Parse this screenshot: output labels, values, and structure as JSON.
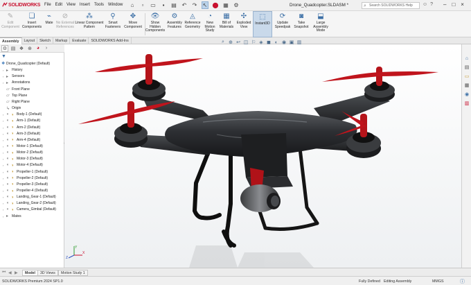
{
  "app": {
    "brand": "SOLIDWORKS",
    "doc_title": "Drone_Quadcopter.SLDASM *",
    "brand_color": "#c8102e"
  },
  "menu": [
    "File",
    "Edit",
    "View",
    "Insert",
    "Tools",
    "Window"
  ],
  "help_search": {
    "placeholder": "Search SOLIDWORKS Help"
  },
  "commands": [
    {
      "label": "Insert\nComponents",
      "enabled": true
    },
    {
      "label": "Mate",
      "enabled": true
    },
    {
      "label": "Linear Component\nPattern",
      "enabled": false
    },
    {
      "label": "Smart\nFasteners",
      "enabled": true
    },
    {
      "label": "Move\nComponent",
      "enabled": true
    },
    {
      "label": "Show\nHidden\nComponents",
      "enabled": true
    },
    {
      "label": "Assembly\nFeatures",
      "enabled": true
    },
    {
      "label": "Reference\nGeometry",
      "enabled": true
    },
    {
      "label": "New\nMotion\nStudy",
      "enabled": true
    },
    {
      "label": "Bill of\nMaterials",
      "enabled": true
    },
    {
      "label": "Exploded\nView",
      "enabled": true
    },
    {
      "label": "Instant3D",
      "enabled": true
    },
    {
      "label": "Update\nSpeedpak",
      "enabled": true
    },
    {
      "label": "Take\nSnapshot",
      "enabled": true
    },
    {
      "label": "Large\nAssembly\nMode",
      "enabled": true
    }
  ],
  "extra_commands": {
    "edit_component": "Edit\nComponent",
    "no_external": "No External\nReferences",
    "pattern": "Linear Component\nPattern"
  },
  "cmd_tabs": [
    "Assembly",
    "Layout",
    "Sketch",
    "Markup",
    "Evaluate",
    "SOLIDWORKS Add-Ins"
  ],
  "tree": {
    "root": "Drone_Quadcopter (Default)",
    "items": [
      {
        "label": "History",
        "kind": "folder"
      },
      {
        "label": "Sensors",
        "kind": "folder"
      },
      {
        "label": "Annotations",
        "kind": "folder"
      },
      {
        "label": "Front Plane",
        "kind": "plane"
      },
      {
        "label": "Top Plane",
        "kind": "plane"
      },
      {
        "label": "Right Plane",
        "kind": "plane"
      },
      {
        "label": "Origin",
        "kind": "origin"
      },
      {
        "label": "Body-1 (Default)",
        "kind": "part"
      },
      {
        "label": "Arm-1 (Default)",
        "kind": "part"
      },
      {
        "label": "Arm-2 (Default)",
        "kind": "part"
      },
      {
        "label": "Arm-3 (Default)",
        "kind": "part"
      },
      {
        "label": "Arm-4 (Default)",
        "kind": "part"
      },
      {
        "label": "Motor-1 (Default)",
        "kind": "part"
      },
      {
        "label": "Motor-2 (Default)",
        "kind": "part"
      },
      {
        "label": "Motor-3 (Default)",
        "kind": "part"
      },
      {
        "label": "Motor-4 (Default)",
        "kind": "part"
      },
      {
        "label": "Propeller-1 (Default)",
        "kind": "part"
      },
      {
        "label": "Propeller-2 (Default)",
        "kind": "part"
      },
      {
        "label": "Propeller-3 (Default)",
        "kind": "part"
      },
      {
        "label": "Propeller-4 (Default)",
        "kind": "part"
      },
      {
        "label": "Landing_Gear-1 (Default)",
        "kind": "part"
      },
      {
        "label": "Landing_Gear-2 (Default)",
        "kind": "part"
      },
      {
        "label": "Camera_Gimbal (Default)",
        "kind": "part"
      },
      {
        "label": "Mates",
        "kind": "folder"
      }
    ]
  },
  "bottom_tabs": [
    "Model",
    "3D Views",
    "Motion Study 1"
  ],
  "status": {
    "edition": "SOLIDWORKS Premium 2024 SP1.0",
    "defined": "Fully Defined",
    "mode": "Editing Assembly",
    "units": "MMGS"
  },
  "colors": {
    "propeller": "#c0141c",
    "body": "#2a2c2f",
    "active_tool": "#c9d9ea"
  }
}
